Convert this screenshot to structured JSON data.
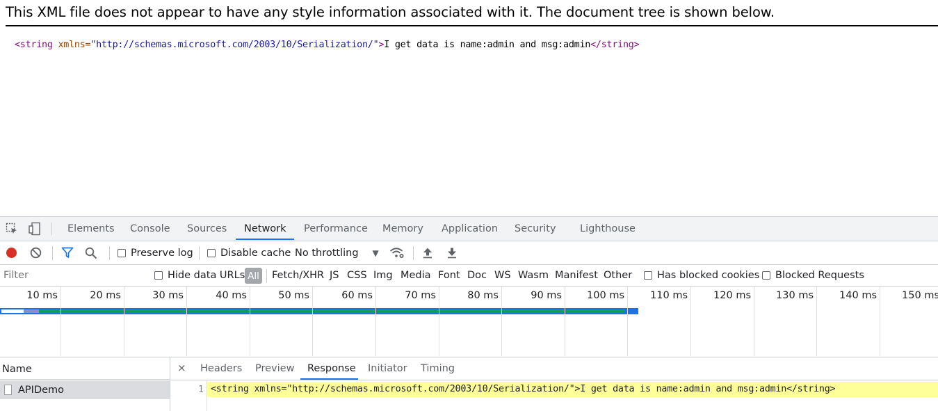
{
  "xml_view": {
    "banner": "This XML file does not appear to have any style information associated with it. The document tree is shown below.",
    "open_tag": "<string",
    "attr_name": " xmlns=",
    "attr_value": "\"http://schemas.microsoft.com/2003/10/Serialization/\"",
    "tag_close": ">",
    "text": "I get data is name:admin and msg:admin",
    "close_tag": "</string>"
  },
  "devtools": {
    "tabs": [
      {
        "label": "Elements"
      },
      {
        "label": "Console"
      },
      {
        "label": "Sources"
      },
      {
        "label": "Network"
      },
      {
        "label": "Performance"
      },
      {
        "label": "Memory"
      },
      {
        "label": "Application"
      },
      {
        "label": "Security"
      },
      {
        "label": "Lighthouse"
      }
    ],
    "active_tab": "Network",
    "toolbar": {
      "preserve_log": "Preserve log",
      "disable_cache": "Disable cache",
      "throttling": "No throttling",
      "throttling_arrow": "▼"
    },
    "filter": {
      "placeholder": "Filter",
      "hide_data_urls": "Hide data URLs",
      "all": "All",
      "types": [
        "Fetch/XHR",
        "JS",
        "CSS",
        "Img",
        "Media",
        "Font",
        "Doc",
        "WS",
        "Wasm",
        "Manifest",
        "Other"
      ],
      "has_blocked_cookies": "Has blocked cookies",
      "blocked_requests": "Blocked Requests"
    },
    "timeline": {
      "ticks": [
        "10 ms",
        "20 ms",
        "30 ms",
        "40 ms",
        "50 ms",
        "60 ms",
        "70 ms",
        "80 ms",
        "90 ms",
        "100 ms",
        "110 ms",
        "120 ms",
        "130 ms",
        "140 ms",
        "150 ms"
      ]
    },
    "requests": {
      "header": "Name",
      "rows": [
        {
          "name": "APIDemo"
        }
      ]
    },
    "detail": {
      "close": "×",
      "tabs": [
        "Headers",
        "Preview",
        "Response",
        "Initiator",
        "Timing"
      ],
      "active_tab": "Response",
      "line_number": "1",
      "response_line": "<string xmlns=\"http://schemas.microsoft.com/2003/10/Serialization/\">I get data is name:admin and msg:admin</string>"
    },
    "colors": {
      "accent": "#1a73e8",
      "record": "#d93025",
      "highlight": "#ffff99"
    }
  }
}
